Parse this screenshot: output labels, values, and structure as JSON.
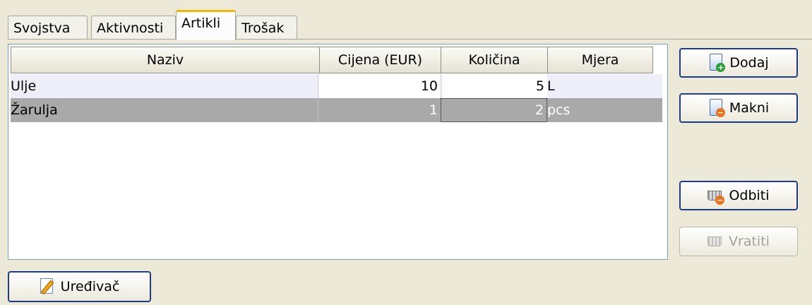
{
  "tabs": [
    "Svojstva",
    "Aktivnosti",
    "Artikli",
    "Trošak"
  ],
  "active_tab": "Artikli",
  "table": {
    "columns": [
      "Naziv",
      "Cijena (EUR)",
      "Količina",
      "Mjera"
    ],
    "rows": [
      {
        "name": "Ulje",
        "price": "10",
        "quantity": "5",
        "unit": "L"
      },
      {
        "name": "Žarulja",
        "price": "1",
        "quantity": "2",
        "unit": "pcs"
      }
    ]
  },
  "buttons": {
    "add": "Dodaj",
    "remove": "Makni",
    "deduct": "Odbiti",
    "restore": "Vratiti",
    "editor": "Uređivač"
  },
  "colors": {
    "background": "#ece9d8",
    "tab_accent": "#f5b400",
    "selected_row": "#a9a9a9",
    "button_border": "#1f3b84"
  }
}
